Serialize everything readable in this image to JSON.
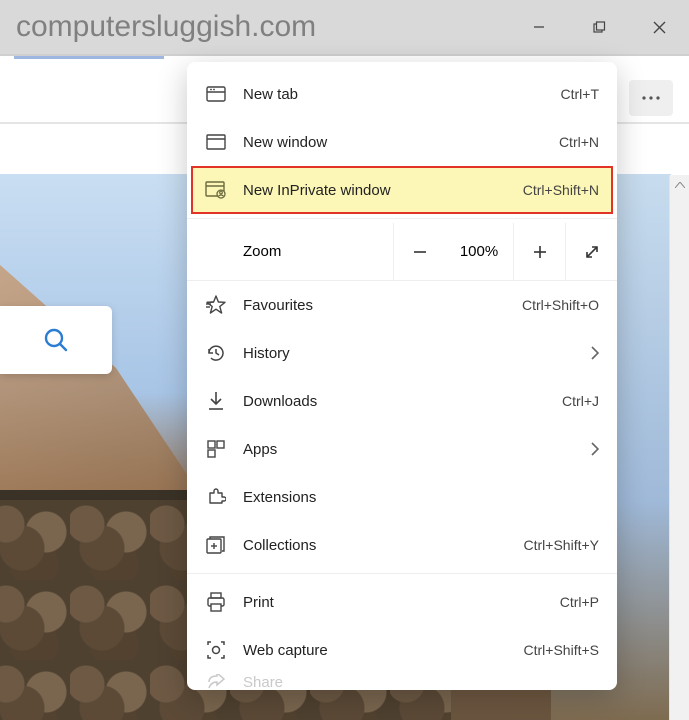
{
  "branding": {
    "watermark": "computersluggish.com"
  },
  "menu": {
    "newTab": {
      "label": "New tab",
      "shortcut": "Ctrl+T"
    },
    "newWindow": {
      "label": "New window",
      "shortcut": "Ctrl+N"
    },
    "newInPrivate": {
      "label": "New InPrivate window",
      "shortcut": "Ctrl+Shift+N"
    },
    "zoom": {
      "label": "Zoom",
      "value": "100%"
    },
    "favourites": {
      "label": "Favourites",
      "shortcut": "Ctrl+Shift+O"
    },
    "history": {
      "label": "History"
    },
    "downloads": {
      "label": "Downloads",
      "shortcut": "Ctrl+J"
    },
    "apps": {
      "label": "Apps"
    },
    "extensions": {
      "label": "Extensions"
    },
    "collections": {
      "label": "Collections",
      "shortcut": "Ctrl+Shift+Y"
    },
    "print": {
      "label": "Print",
      "shortcut": "Ctrl+P"
    },
    "webCapture": {
      "label": "Web capture",
      "shortcut": "Ctrl+Shift+S"
    },
    "share": {
      "label": "Share"
    }
  }
}
